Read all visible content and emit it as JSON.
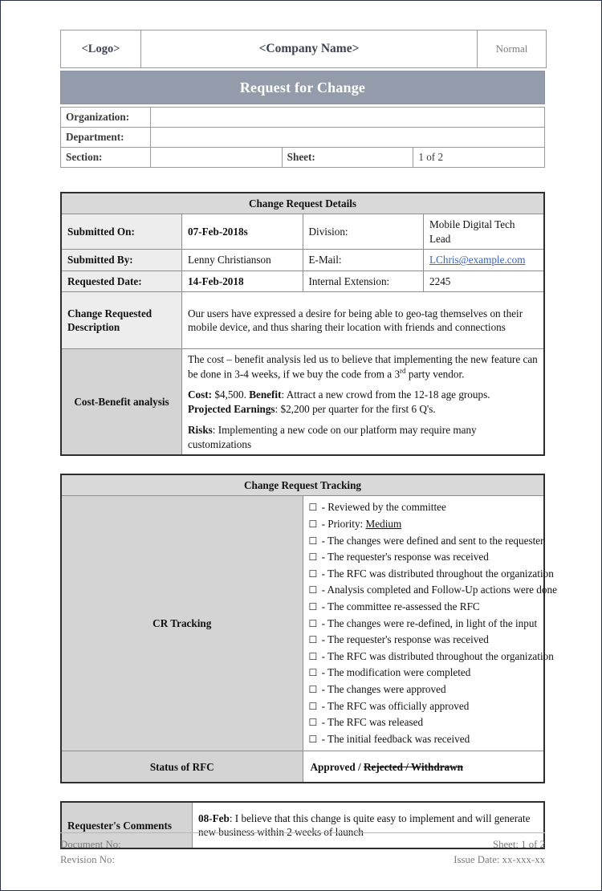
{
  "header": {
    "logo": "<Logo>",
    "company": "<Company Name>",
    "classification": "Normal",
    "title": "Request for Change",
    "organization_label": "Organization:",
    "organization_value": "",
    "department_label": "Department:",
    "department_value": "",
    "section_label": "Section:",
    "section_value": "",
    "sheet_label": "Sheet:",
    "sheet_value": "1 of 2"
  },
  "details": {
    "section_title": "Change Request Details",
    "rows": [
      {
        "label": "Submitted On:",
        "value": "07-Feb-2018s",
        "label2": "Division:",
        "value2": "Mobile Digital Tech Lead"
      },
      {
        "label": "Submitted By:",
        "value": "Lenny Christianson",
        "label2": "E-Mail:",
        "value2": "LChris@example.com"
      },
      {
        "label": "Requested Date:",
        "value": "14-Feb-2018",
        "label2": "Internal Extension:",
        "value2": "2245"
      }
    ],
    "description_label": "Change Requested Description",
    "description_text": "Our users have expressed a desire for being able to geo-tag themselves on their mobile device, and thus sharing their location with friends and connections",
    "cost_benefit_label": "Cost-Benefit analysis",
    "cost_benefit": {
      "para1_a": "The cost – benefit analysis led us to believe that implementing the new feature can be done in 3-4 weeks, if we buy the code from a 3",
      "para1_sup": "rd",
      "para1_b": " party vendor.",
      "cost_label": "Cost:",
      "cost_value": " $4,500. ",
      "benefit_label": "Benefit",
      "benefit_value": ": Attract a new crowd from the 12-18 age groups.",
      "earnings_label": "Projected Earnings",
      "earnings_value": ": $2,200 per quarter for the first 6 Q's.",
      "risks_label": "Risks",
      "risks_value": ": Implementing a new code on our platform may require many customizations"
    }
  },
  "tracking": {
    "section_title": "Change Request Tracking",
    "row_label": "CR Tracking",
    "checkbox_glyph": "☐",
    "items": [
      {
        "text": "- Reviewed by the committee",
        "underlined": ""
      },
      {
        "text": "- Priority: ",
        "underlined": "Medium "
      },
      {
        "text": "- The changes were defined and sent to the requester",
        "underlined": ""
      },
      {
        "text": "- The requester's response was received",
        "underlined": ""
      },
      {
        "text": "- The RFC was distributed throughout the organization",
        "underlined": ""
      },
      {
        "text": "- Analysis completed and Follow-Up actions were done",
        "underlined": ""
      },
      {
        "text": "- The committee re-assessed the RFC",
        "underlined": ""
      },
      {
        "text": "- The changes were re-defined, in light of the input",
        "underlined": ""
      },
      {
        "text": "- The requester's response was received",
        "underlined": ""
      },
      {
        "text": "- The RFC was distributed throughout the organization",
        "underlined": ""
      },
      {
        "text": "- The modification were completed",
        "underlined": ""
      },
      {
        "text": "- The changes were approved",
        "underlined": ""
      },
      {
        "text": "- The RFC was officially approved",
        "underlined": ""
      },
      {
        "text": "- The RFC was released",
        "underlined": ""
      },
      {
        "text": "- The initial feedback was received",
        "underlined": ""
      }
    ],
    "status_label": "Status of RFC",
    "status_approved": "Approved / ",
    "status_struck": "Rejected / Withdrawn"
  },
  "comments": {
    "label": "Requester's Comments",
    "date": "08-Feb",
    "text": ": I believe that this change is quite easy to implement and will generate new business within 2 weeks of launch"
  },
  "footer": {
    "document_no": "Document No:",
    "revision_no": "Revision No:",
    "sheet": "Sheet: 1 of 2",
    "issue_date": "Issue Date: xx-xxx-xx"
  },
  "colors": {
    "title_bar": "#949cab",
    "section_head": "#d9d9d9",
    "label_cell": "#d4d4d4",
    "label_cell_light": "#ededed",
    "link": "#3366cc"
  }
}
